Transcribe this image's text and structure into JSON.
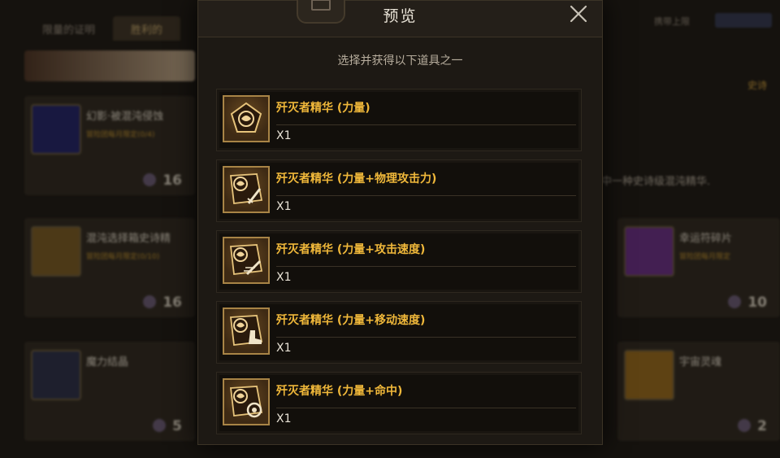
{
  "modal": {
    "title": "预览",
    "subtitle": "选择并获得以下道具之一",
    "items": [
      {
        "name": "歼灭者精华 (力量)",
        "qty": "X1",
        "icon": "essence-pentagon-icon"
      },
      {
        "name": "歼灭者精华 (力量+物理攻击力)",
        "qty": "X1",
        "icon": "essence-sword-icon"
      },
      {
        "name": "歼灭者精华 (力量+攻击速度)",
        "qty": "X1",
        "icon": "essence-speed-icon"
      },
      {
        "name": "歼灭者精华 (力量+移动速度)",
        "qty": "X1",
        "icon": "essence-boot-icon"
      },
      {
        "name": "歼灭者精华 (力量+命中)",
        "qty": "X1",
        "icon": "essence-target-icon"
      }
    ]
  },
  "background": {
    "tabs": [
      "限量的证明",
      "胜利的"
    ],
    "cards": [
      {
        "name": "幻影·被混沌侵蚀",
        "limit": "冒险团每月限定(0/4)",
        "price": "16"
      },
      {
        "name": "混沌选择箱史诗精",
        "limit": "冒险团每月限定(0/10)",
        "price": "16"
      },
      {
        "name": "魔力结晶",
        "limit": "",
        "price": "5"
      },
      {
        "name": "幸运符碎片",
        "limit": "冒险团每月限定",
        "price": "10"
      },
      {
        "name": "宇宙灵魂",
        "limit": "",
        "price": "2"
      }
    ],
    "right_header": "携带上限",
    "right_tag": "史诗",
    "right_text": "中一种史诗级混沌精华."
  },
  "colors": {
    "accent_gold": "#f0b83a",
    "modal_bg": "#1d1914",
    "frame_gold": "#a88446"
  }
}
